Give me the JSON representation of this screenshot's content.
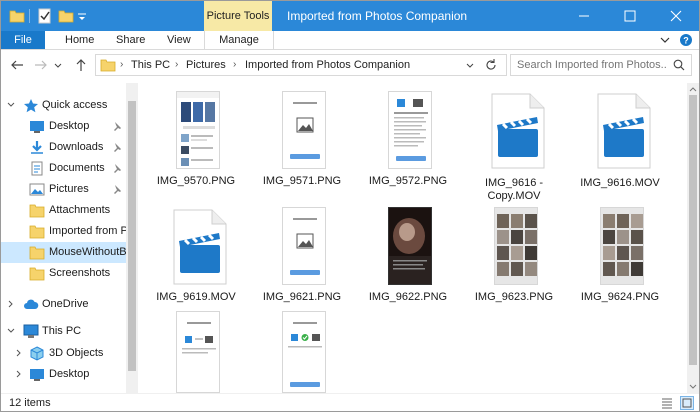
{
  "titlebar": {
    "context_tab": "Picture Tools",
    "title": "Imported from Photos Companion"
  },
  "ribbon": {
    "tabs": [
      "File",
      "Home",
      "Share",
      "View",
      "Manage"
    ]
  },
  "address": {
    "crumbs": [
      "This PC",
      "Pictures",
      "Imported from Photos Companion"
    ]
  },
  "search": {
    "placeholder": "Search Imported from Photos..."
  },
  "sidebar": {
    "items": [
      {
        "label": "Quick access",
        "icon": "star-icon"
      },
      {
        "label": "Desktop",
        "icon": "desktop-icon"
      },
      {
        "label": "Downloads",
        "icon": "download-icon"
      },
      {
        "label": "Documents",
        "icon": "documents-icon"
      },
      {
        "label": "Pictures",
        "icon": "pictures-icon"
      },
      {
        "label": "Attachments",
        "icon": "folder-icon"
      },
      {
        "label": "Imported from P",
        "icon": "folder-icon"
      },
      {
        "label": "MouseWithoutB",
        "icon": "folder-icon"
      },
      {
        "label": "Screenshots",
        "icon": "folder-icon"
      },
      {
        "label": "OneDrive",
        "icon": "cloud-icon"
      },
      {
        "label": "This PC",
        "icon": "computer-icon"
      },
      {
        "label": "3D Objects",
        "icon": "cube-icon"
      },
      {
        "label": "Desktop",
        "icon": "desktop-icon"
      }
    ]
  },
  "files": [
    {
      "name": "IMG_9570.PNG",
      "kind": "screenshot-cards"
    },
    {
      "name": "IMG_9571.PNG",
      "kind": "screenshot-image"
    },
    {
      "name": "IMG_9572.PNG",
      "kind": "screenshot-text"
    },
    {
      "name": "IMG_9616 - Copy.MOV",
      "kind": "video"
    },
    {
      "name": "IMG_9616.MOV",
      "kind": "video"
    },
    {
      "name": "IMG_9619.MOV",
      "kind": "video"
    },
    {
      "name": "IMG_9621.PNG",
      "kind": "screenshot-image"
    },
    {
      "name": "IMG_9622.PNG",
      "kind": "photo-dark"
    },
    {
      "name": "IMG_9623.PNG",
      "kind": "photo-grid"
    },
    {
      "name": "IMG_9624.PNG",
      "kind": "photo-grid"
    },
    {
      "name": "",
      "kind": "screenshot-send"
    },
    {
      "name": "",
      "kind": "screenshot-check"
    }
  ],
  "status": {
    "count": "12 items"
  },
  "colors": {
    "titlebar": "#2b88d8",
    "file_tab": "#1979ca",
    "context_tab": "#f7e9a6",
    "selection": "#cce8ff",
    "video_blue": "#1e79c8",
    "folder": "#f6d36b"
  }
}
